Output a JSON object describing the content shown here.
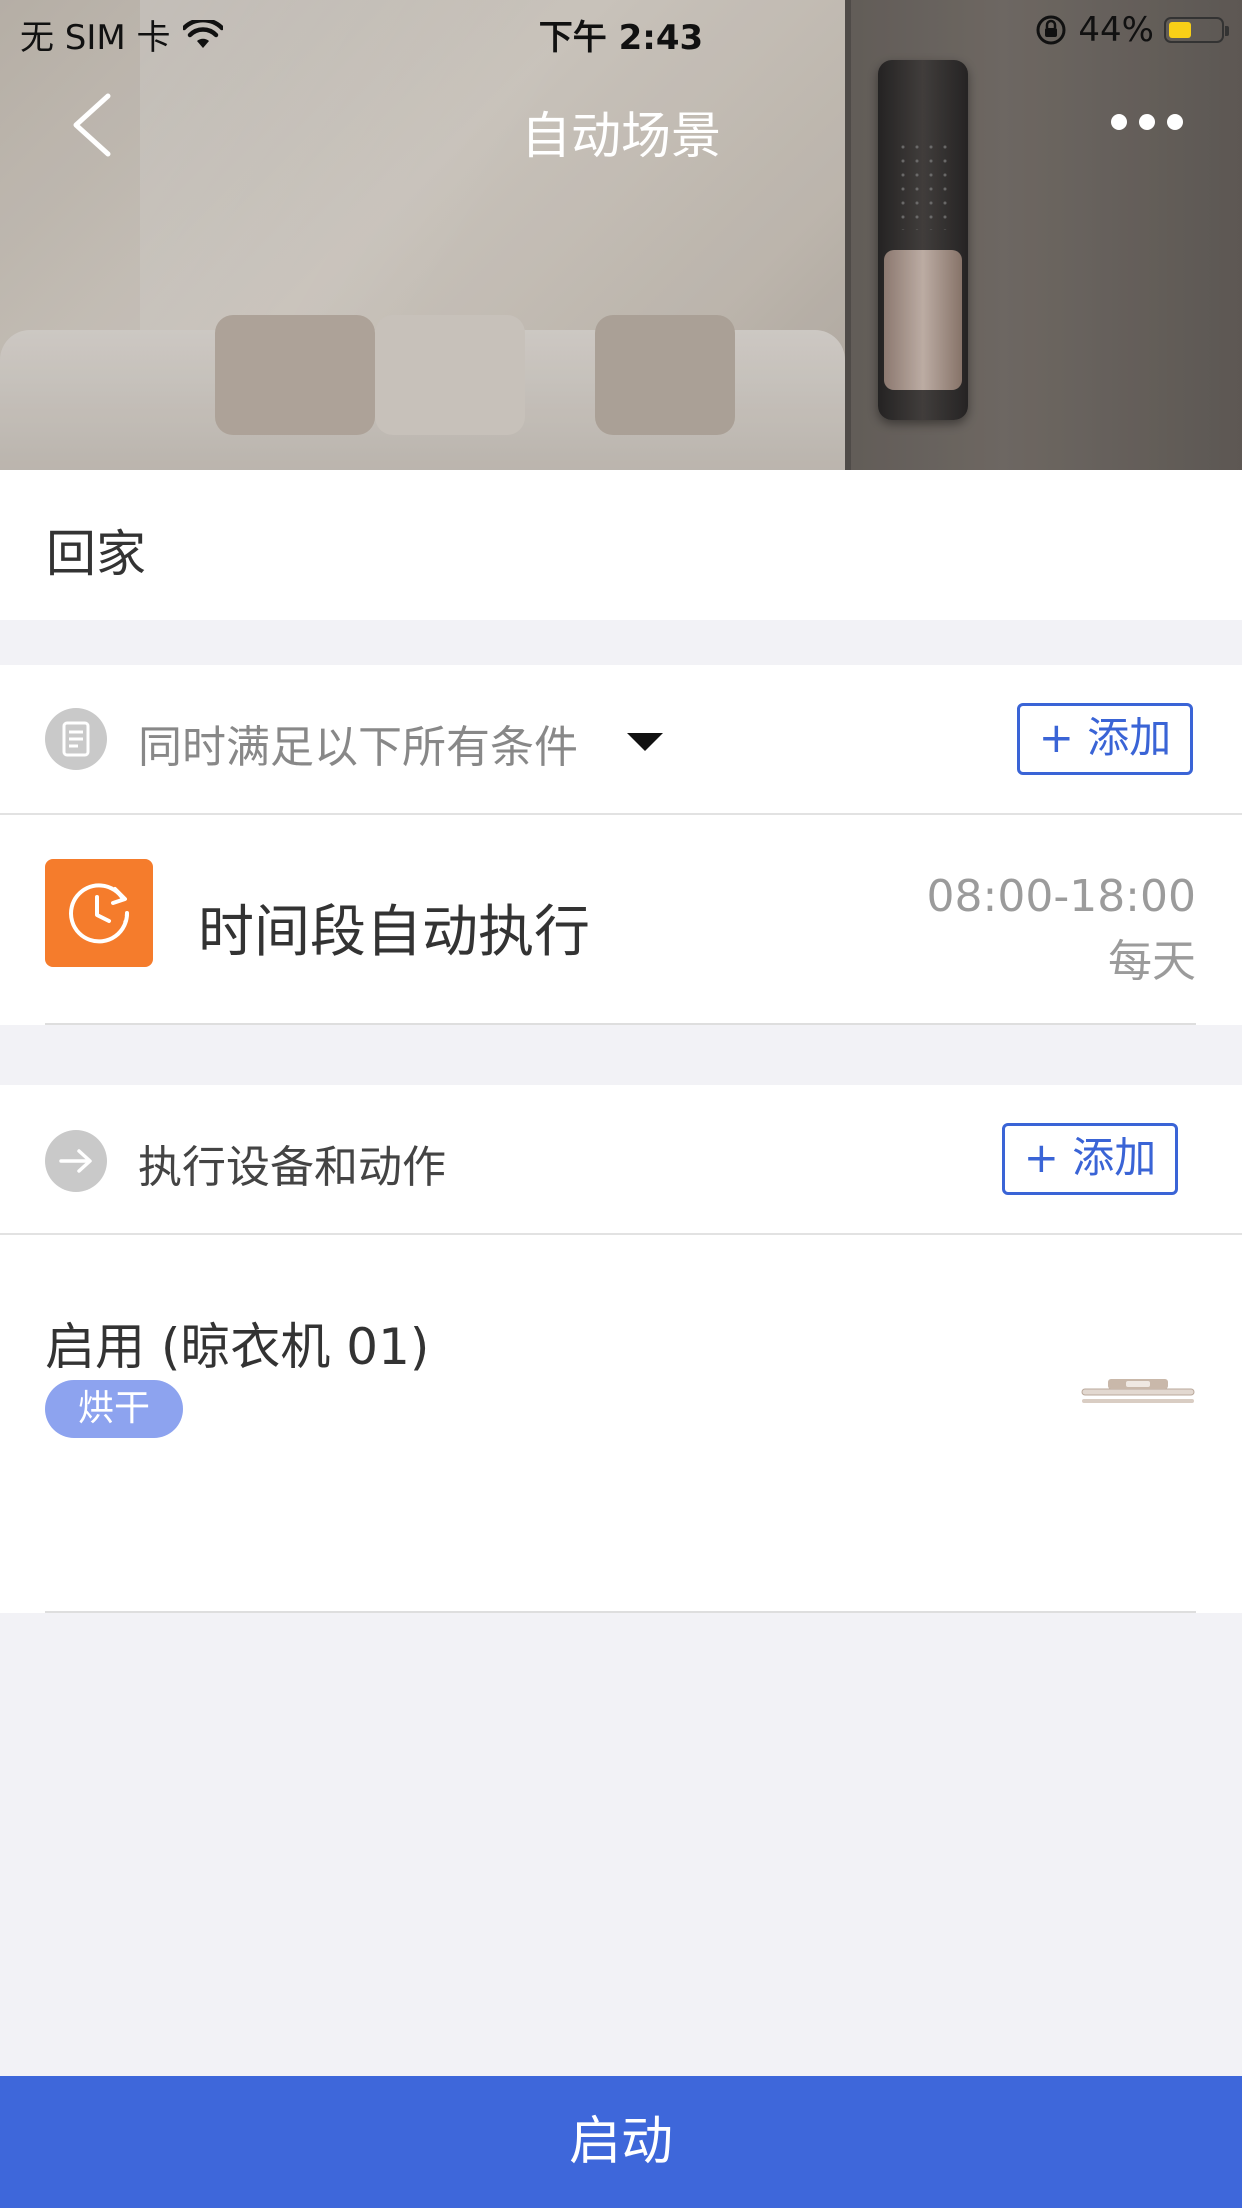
{
  "status_bar": {
    "carrier": "无 SIM 卡",
    "time": "下午 2:43",
    "battery_percent": "44%",
    "battery_level": 0.44
  },
  "nav": {
    "title": "自动场景"
  },
  "scene": {
    "name": "回家"
  },
  "conditions": {
    "header": "同时满足以下所有条件",
    "add_label": "+ 添加",
    "items": [
      {
        "title": "时间段自动执行",
        "time_range": "08:00-18:00",
        "frequency": "每天",
        "icon": "clock-icon"
      }
    ]
  },
  "actions": {
    "header": "执行设备和动作",
    "add_label": "+ 添加",
    "items": [
      {
        "title": "启用 (晾衣机 01)",
        "tag": "烘干",
        "thumbnail": "clothes-dryer-icon"
      }
    ]
  },
  "footer": {
    "start_label": "启动"
  },
  "colors": {
    "accent_blue": "#3e67da",
    "orange": "#f57c2c",
    "tag_blue": "#8da3ef",
    "background": "#f2f2f6"
  }
}
